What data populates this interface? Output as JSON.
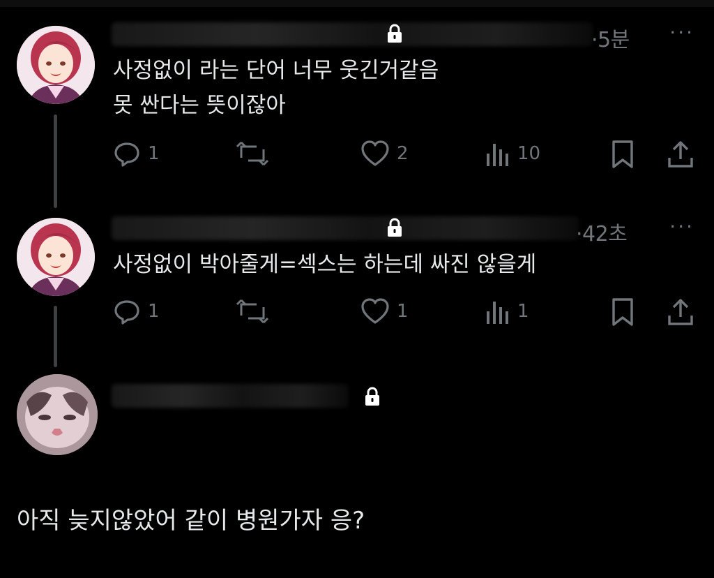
{
  "tweets": [
    {
      "time": "·5분",
      "more": "···",
      "lines": [
        "사정없이 라는 단어 너무 웃긴거같음",
        "못 싼다는 뜻이잖아"
      ],
      "stats": {
        "replies": "1",
        "retweets": "",
        "likes": "2",
        "views": "10"
      }
    },
    {
      "time": "·42초",
      "more": "···",
      "lines": [
        "사정없이 박아줄게=섹스는 하는데 싸진 않을게"
      ],
      "stats": {
        "replies": "1",
        "retweets": "",
        "likes": "1",
        "views": "1"
      }
    }
  ],
  "reply_text": "아직 늦지않았어 같이 병원가자 응?",
  "icons": [
    "lock-icon",
    "more-icon",
    "reply-icon",
    "retweet-icon",
    "like-icon",
    "views-icon",
    "bookmark-icon",
    "share-icon"
  ],
  "colors": {
    "background": "#000000",
    "text": "#e7e9ea",
    "muted": "#71767b",
    "thread_line": "#3e4144"
  }
}
